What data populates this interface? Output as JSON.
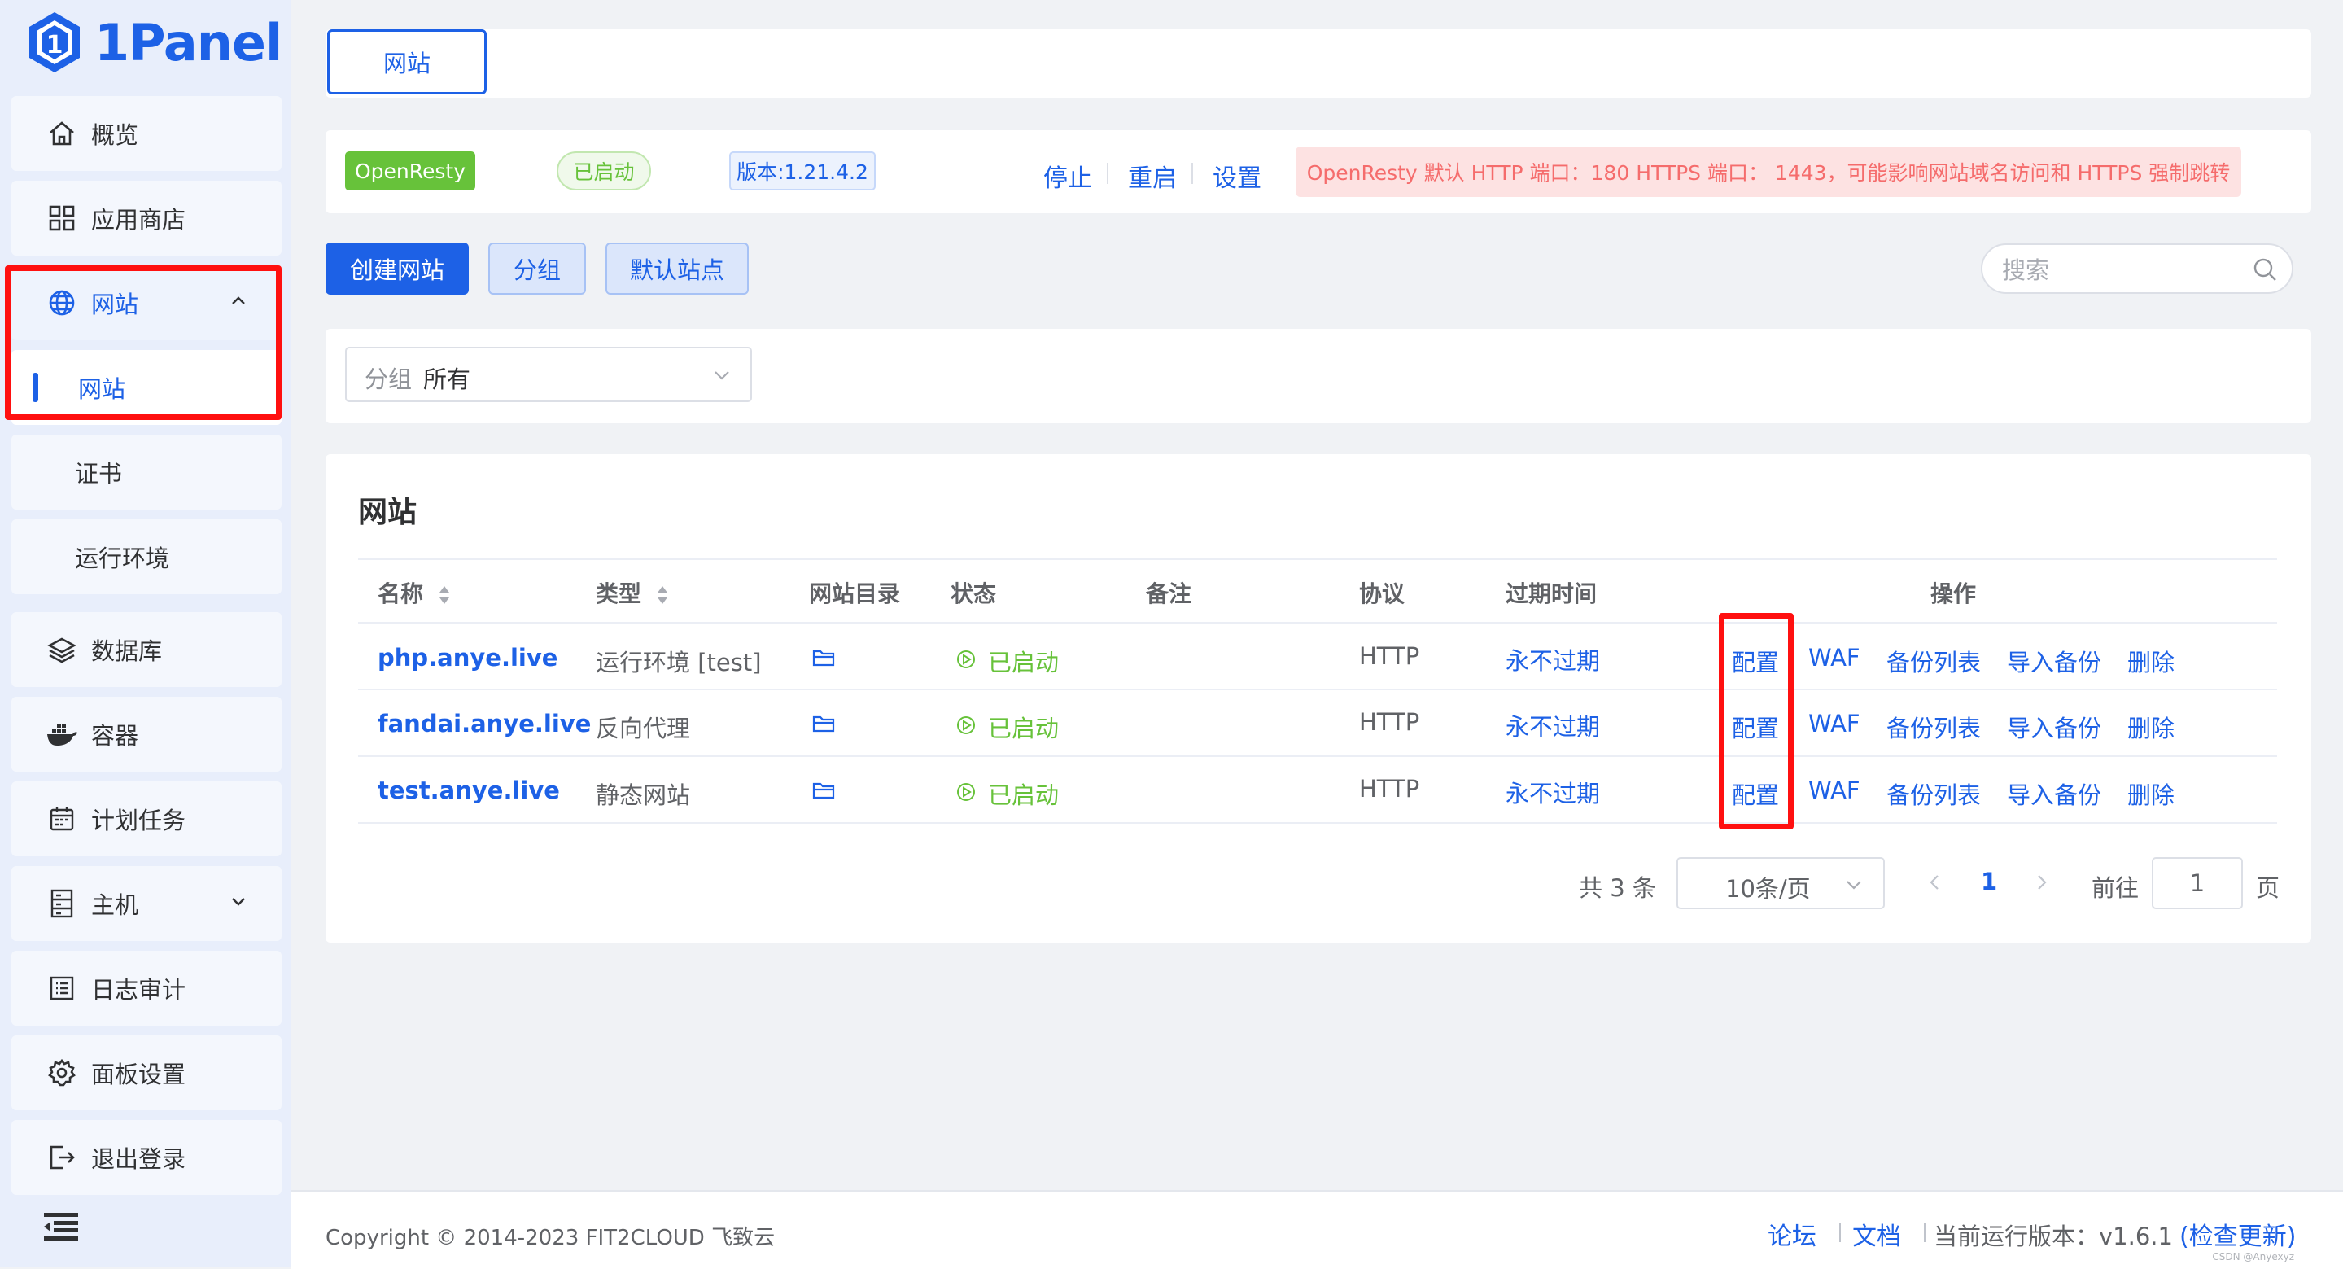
{
  "app": {
    "logo_text": "1Panel"
  },
  "sidebar": {
    "items": [
      {
        "label": "概览",
        "icon": "home-icon"
      },
      {
        "label": "应用商店",
        "icon": "apps-icon"
      },
      {
        "label": "网站",
        "icon": "globe-icon",
        "expanded": true
      },
      {
        "label": "网站",
        "active": true
      },
      {
        "label": "证书"
      },
      {
        "label": "运行环境"
      },
      {
        "label": "数据库",
        "icon": "layers-icon"
      },
      {
        "label": "容器",
        "icon": "docker-icon"
      },
      {
        "label": "计划任务",
        "icon": "calendar-icon"
      },
      {
        "label": "主机",
        "icon": "server-icon"
      },
      {
        "label": "日志审计",
        "icon": "log-icon"
      },
      {
        "label": "面板设置",
        "icon": "gear-icon"
      },
      {
        "label": "退出登录",
        "icon": "logout-icon"
      }
    ]
  },
  "tabs": [
    {
      "label": "网站"
    }
  ],
  "openresty": {
    "name": "OpenResty",
    "status": "已启动",
    "version": "版本:1.21.4.2",
    "actions": {
      "stop": "停止",
      "restart": "重启",
      "settings": "设置"
    },
    "warning": "OpenResty 默认 HTTP 端口：180 HTTPS 端口： 1443，可能影响网站域名访问和 HTTPS 强制跳转"
  },
  "toolbar": {
    "create": "创建网站",
    "group": "分组",
    "default_site": "默认站点",
    "search_placeholder": "搜索"
  },
  "filter": {
    "prefix": "分组",
    "value": "所有"
  },
  "panel": {
    "title": "网站"
  },
  "table": {
    "headers": {
      "name": "名称",
      "type": "类型",
      "dir": "网站目录",
      "status": "状态",
      "remark": "备注",
      "protocol": "协议",
      "expire": "过期时间",
      "ops": "操作"
    },
    "rows": [
      {
        "name": "php.anye.live",
        "type": "运行环境 [test]",
        "status": "已启动",
        "protocol": "HTTP",
        "expire": "永不过期"
      },
      {
        "name": "fandai.anye.live",
        "type": "反向代理",
        "status": "已启动",
        "protocol": "HTTP",
        "expire": "永不过期"
      },
      {
        "name": "test.anye.live",
        "type": "静态网站",
        "status": "已启动",
        "protocol": "HTTP",
        "expire": "永不过期"
      }
    ],
    "row_ops": {
      "config": "配置",
      "waf": "WAF",
      "backups": "备份列表",
      "import": "导入备份",
      "delete": "删除"
    }
  },
  "pagination": {
    "total": "共 3 条",
    "page_size": "10条/页",
    "current": "1",
    "goto_label": "前往",
    "goto_value": "1",
    "page_suffix": "页"
  },
  "footer": {
    "copyright": "Copyright © 2014-2023 FIT2CLOUD 飞致云",
    "forum": "论坛",
    "docs": "文档",
    "version_text": "当前运行版本：v1.6.1",
    "check_update": "(检查更新)",
    "watermark": "CSDN @Anyexyz"
  },
  "colors": {
    "primary": "#1d61e6",
    "success": "#67c23a",
    "danger": "#f56c6c",
    "highlight": "#ff1010"
  }
}
